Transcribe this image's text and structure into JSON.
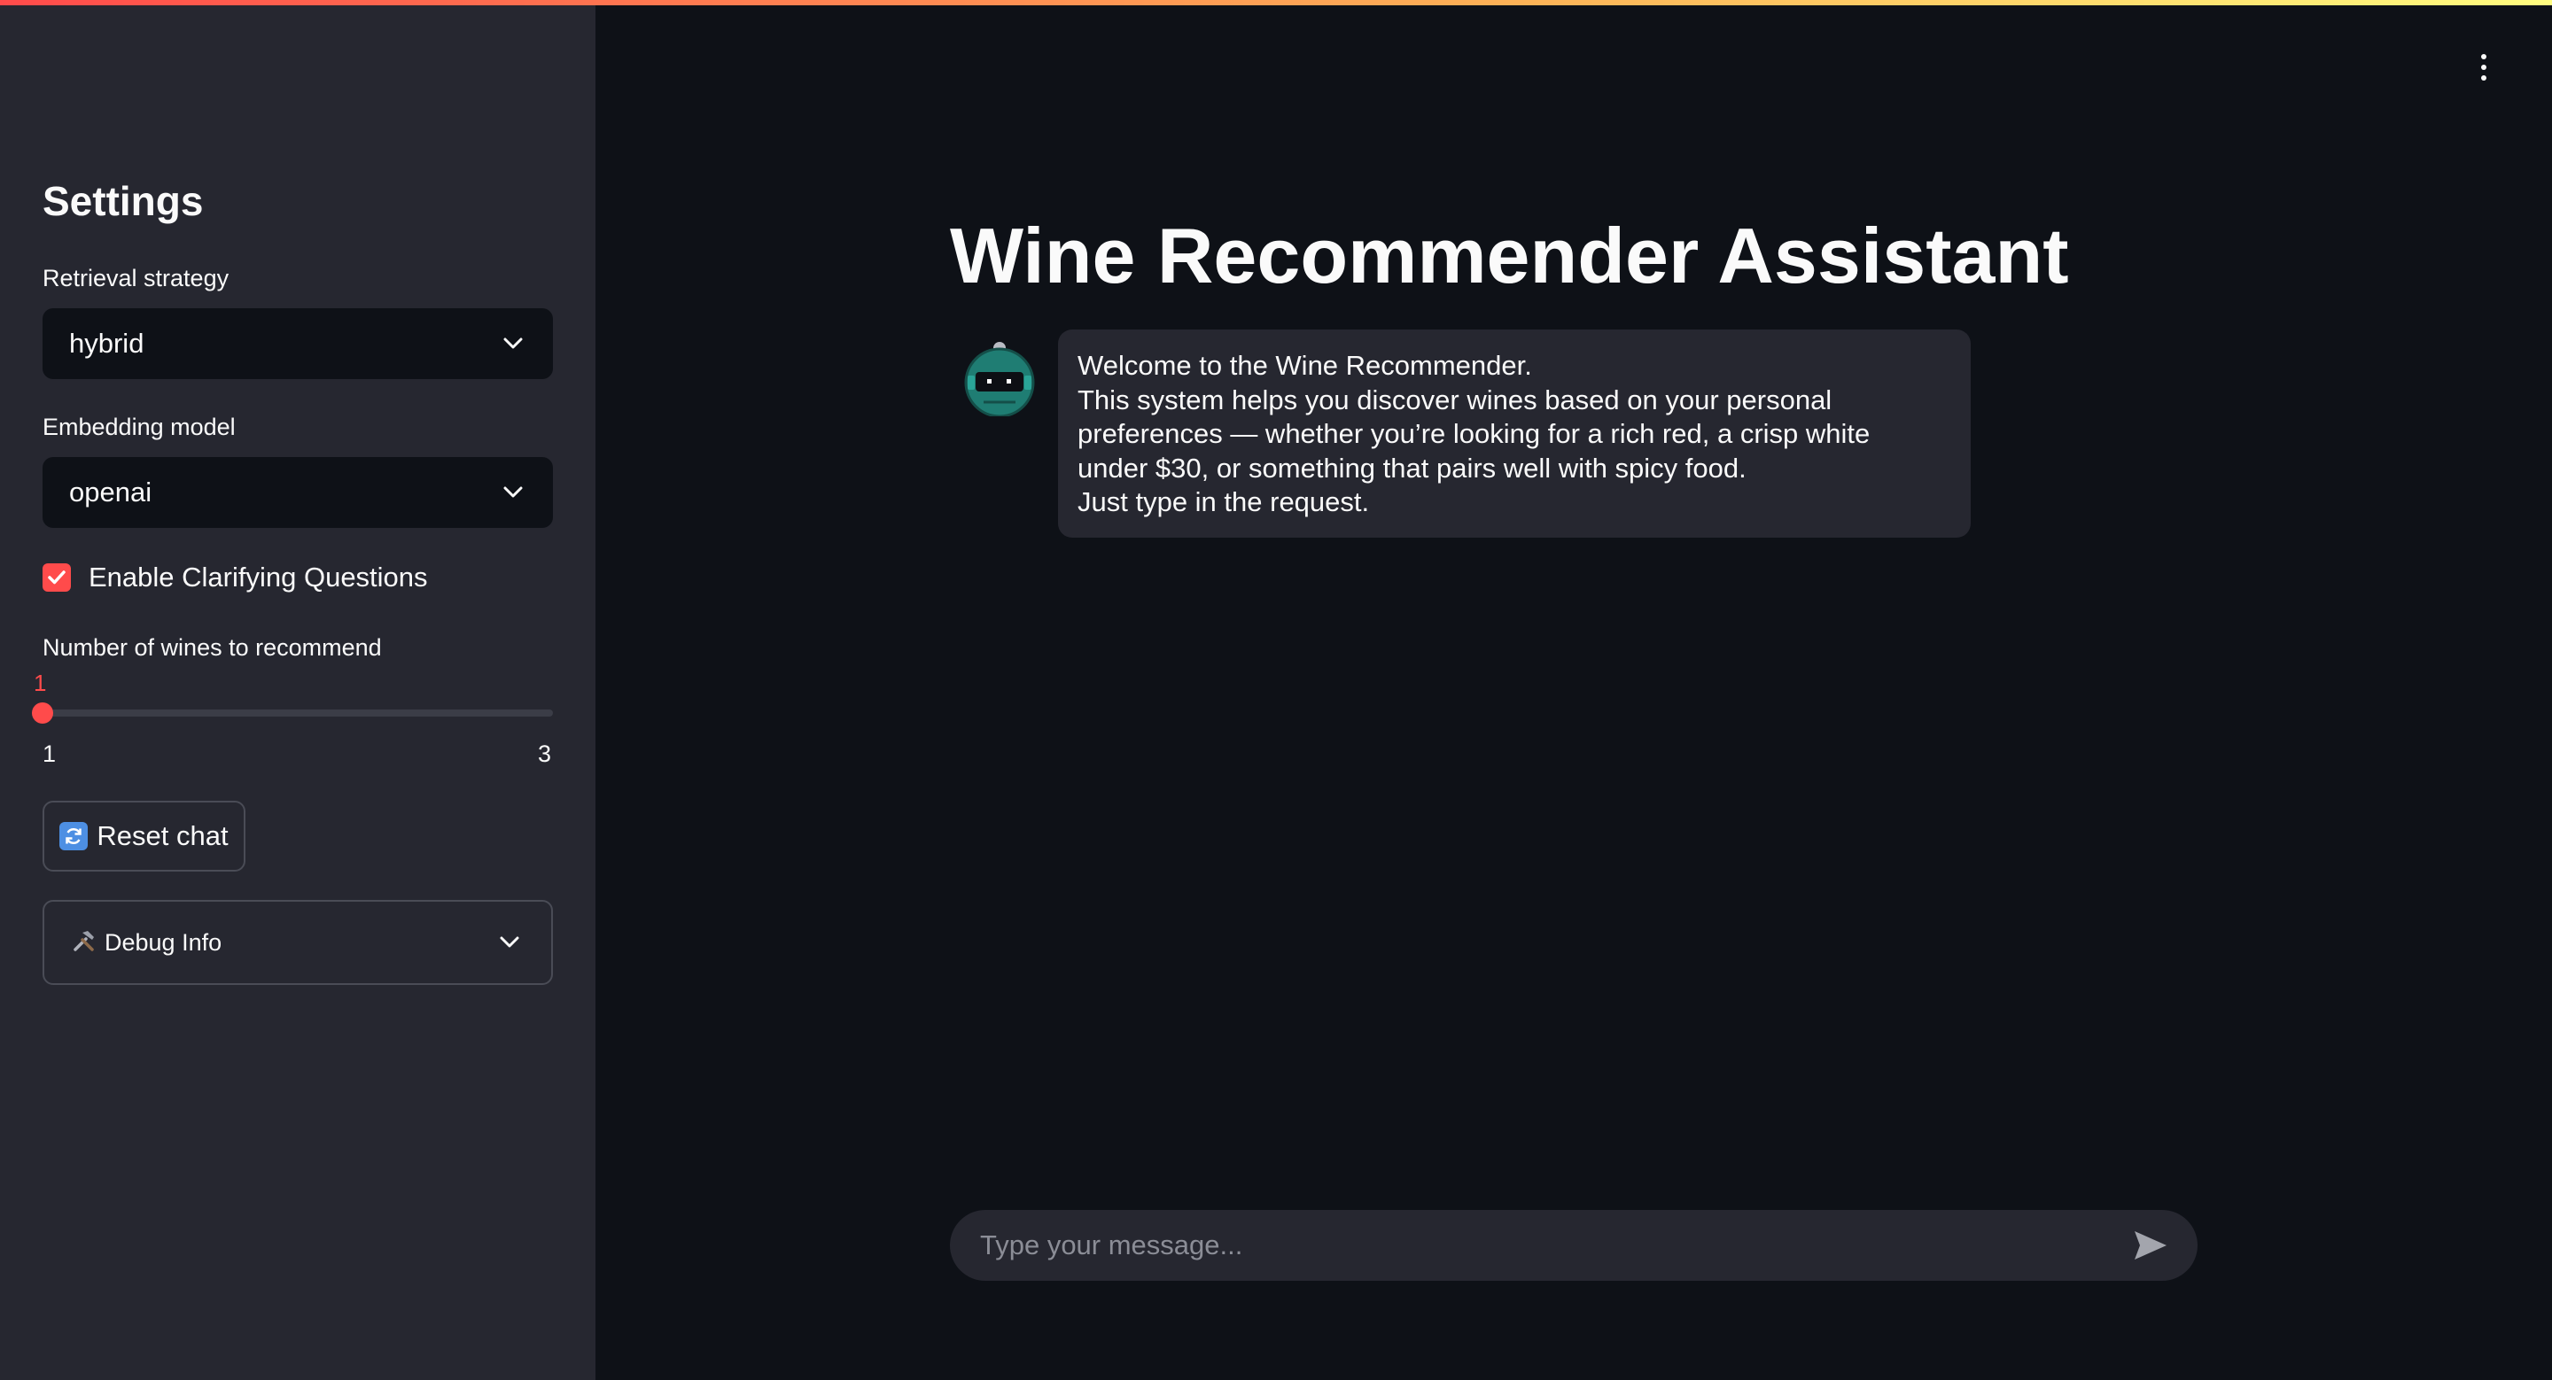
{
  "sidebar": {
    "title": "Settings",
    "retrieval": {
      "label": "Retrieval strategy",
      "value": "hybrid"
    },
    "embedding": {
      "label": "Embedding model",
      "value": "openai"
    },
    "clarifying": {
      "label": "Enable Clarifying Questions",
      "checked": true
    },
    "slider": {
      "label": "Number of wines to recommend",
      "value": "1",
      "min": "1",
      "max": "3"
    },
    "reset_label": "Reset chat",
    "debug_label": "Debug Info"
  },
  "main": {
    "title": "Wine Recommender Assistant",
    "welcome_lines": [
      "Welcome to the Wine Recommender.",
      "This system helps you discover wines based on your personal",
      "preferences — whether you’re looking for a rich red, a crisp white",
      "under $30, or something that pairs well with spicy food.",
      "Just type in the request."
    ],
    "input_placeholder": "Type your message..."
  },
  "colors": {
    "accent": "#ff4b4b",
    "background": "#0e1117",
    "sidebar": "#262730"
  },
  "icons": [
    "chevron-down-icon",
    "check-icon",
    "refresh-icon",
    "tools-icon",
    "robot-avatar-icon",
    "send-icon",
    "more-vertical-icon"
  ]
}
